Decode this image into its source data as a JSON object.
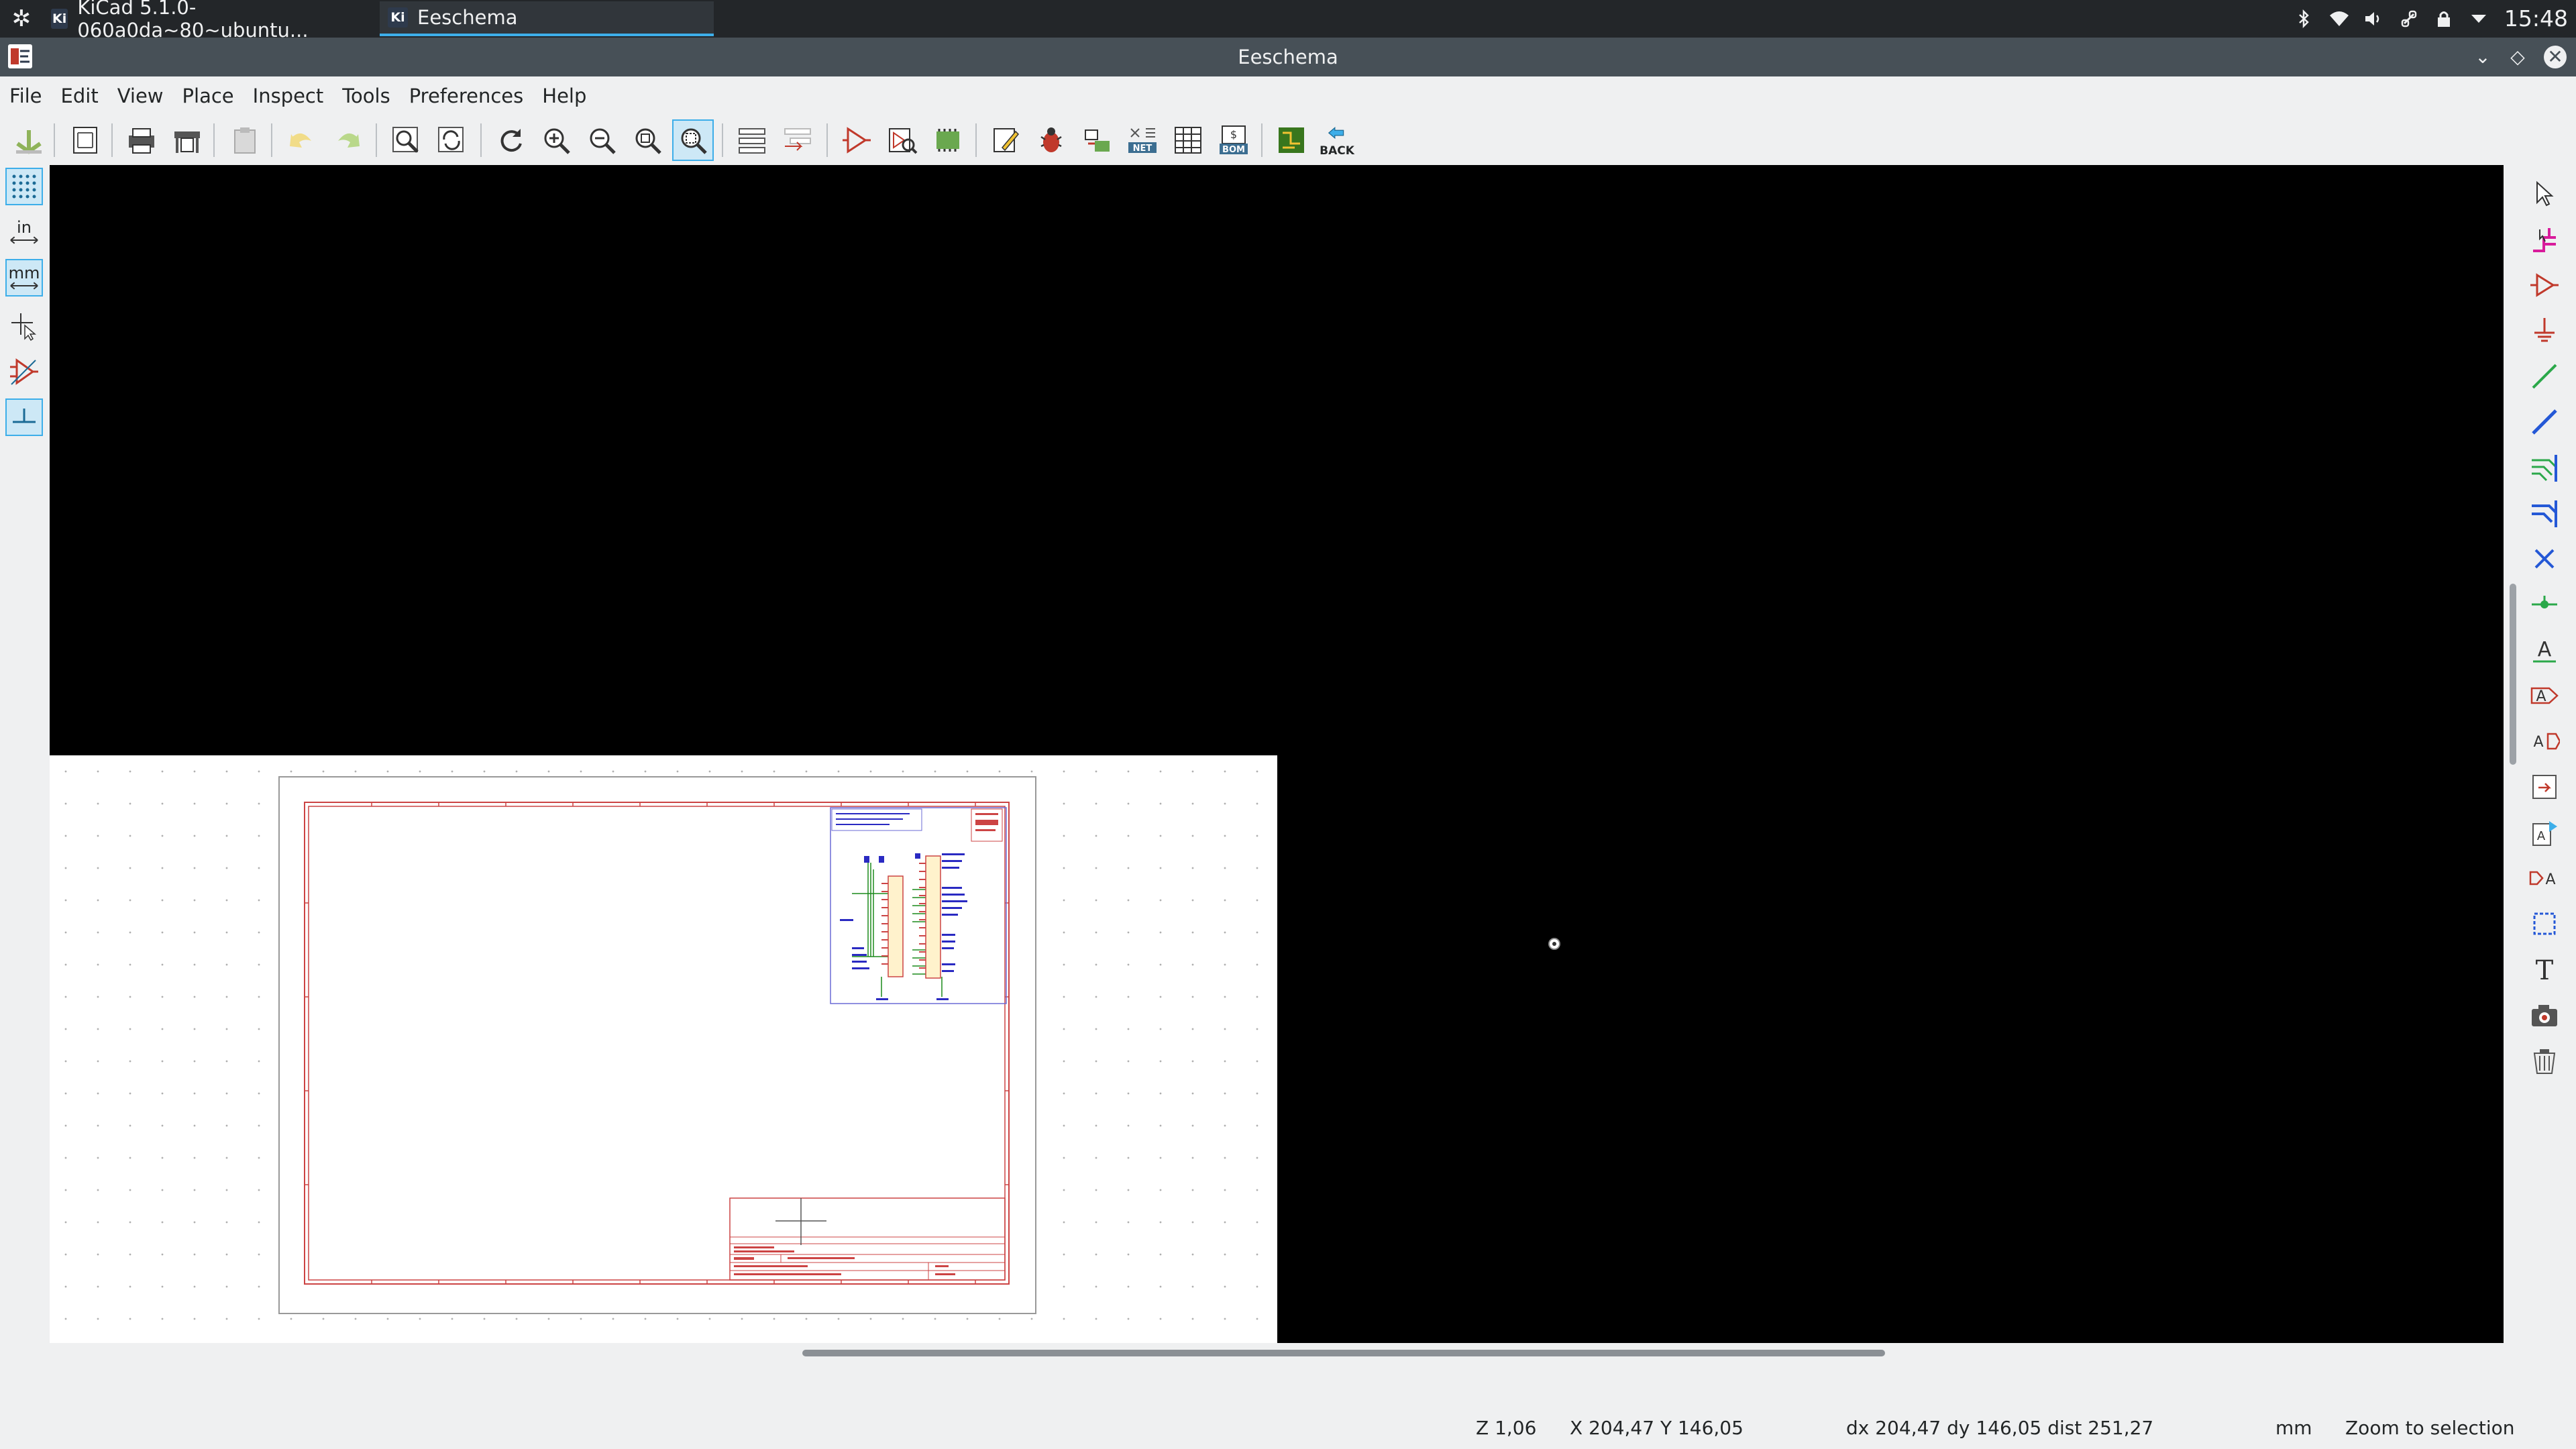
{
  "taskbar": {
    "tasks": [
      {
        "label": "KiCad 5.1.0-060a0da~80~ubuntu...",
        "badge": "Ki"
      },
      {
        "label": "Eeschema",
        "badge": "Ki"
      }
    ],
    "tray_icons": [
      "bluetooth-icon",
      "wifi-icon",
      "volume-icon",
      "link-icon",
      "lock-icon",
      "expand-tray-icon"
    ],
    "clock": "15:48"
  },
  "window": {
    "title": "Eeschema"
  },
  "menu": {
    "items": [
      "File",
      "Edit",
      "View",
      "Place",
      "Inspect",
      "Tools",
      "Preferences",
      "Help"
    ]
  },
  "toolbar": {
    "back_label": "BACK",
    "net_label": "NET",
    "bom_label": "BOM"
  },
  "left_toolbar": {
    "inch_label": "in",
    "mm_label": "mm"
  },
  "statusbar": {
    "zoom": "Z 1,06",
    "cursor_xy": "X 204,47  Y 146,05",
    "delta": "dx 204,47  dy 146,05  dist 251,27",
    "units": "mm",
    "mode": "Zoom to selection"
  },
  "colors": {
    "canvas": "#000000",
    "sheet_border": "#840000",
    "wire": "#008400",
    "label": "#0000c2",
    "selection": "#3daee9"
  }
}
